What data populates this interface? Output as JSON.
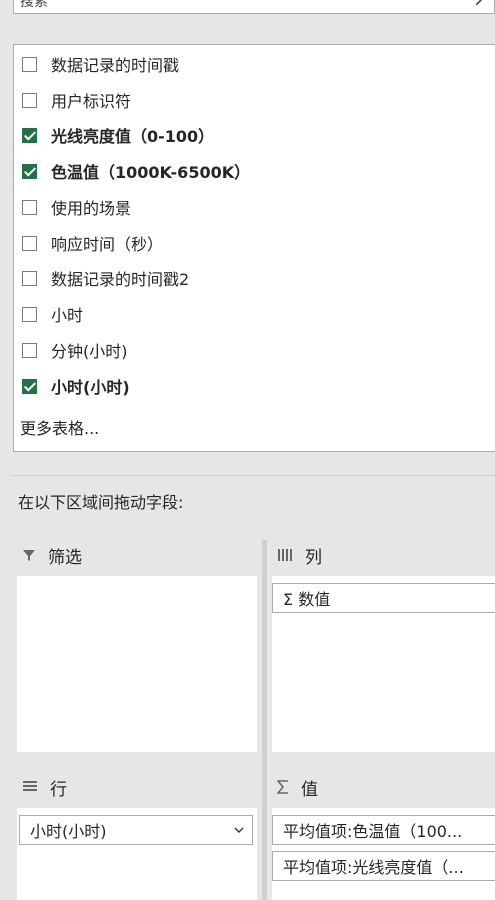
{
  "search": {
    "value": "搜索"
  },
  "fields": [
    {
      "label": "数据记录的时间戳",
      "checked": false
    },
    {
      "label": "用户标识符",
      "checked": false
    },
    {
      "label": "光线亮度值（0-100）",
      "checked": true
    },
    {
      "label": "色温值（1000K-6500K）",
      "checked": true
    },
    {
      "label": "使用的场景",
      "checked": false
    },
    {
      "label": "响应时间（秒）",
      "checked": false
    },
    {
      "label": "数据记录的时间戳2",
      "checked": false
    },
    {
      "label": "小时",
      "checked": false
    },
    {
      "label": "分钟(小时)",
      "checked": false
    },
    {
      "label": "小时(小时)",
      "checked": true
    }
  ],
  "more_tables": "更多表格...",
  "drag_hint": "在以下区域间拖动字段:",
  "areas": {
    "filter": {
      "title": "筛选",
      "icon": "filter-icon"
    },
    "columns": {
      "title": "列",
      "icon": "columns-icon",
      "items": [
        "Σ 数值"
      ]
    },
    "rows": {
      "title": "行",
      "icon": "rows-icon",
      "items": [
        "小时(小时)"
      ]
    },
    "values": {
      "title": "值",
      "icon": "sigma-icon",
      "items": [
        "平均值项:色温值（100...",
        "平均值项:光线亮度值（..."
      ]
    }
  }
}
